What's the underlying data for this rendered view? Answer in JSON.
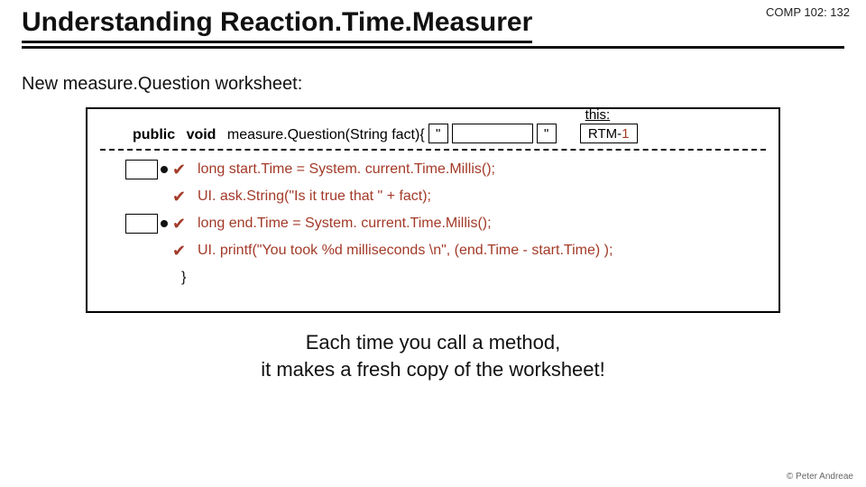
{
  "header": {
    "course_tag": "COMP 102: 132",
    "title": "Understanding Reaction.Time.Measurer"
  },
  "subhead": "New measure.Question worksheet:",
  "signature": {
    "kw_public": "public",
    "kw_void": "void",
    "method": "measure.Question(String fact){",
    "quote1": "\"",
    "quote2": "\"",
    "this_label": "this:",
    "rtm_text": "RTM-",
    "rtm_num": "1"
  },
  "lines": {
    "l1": "long start.Time = System. current.Time.Millis();",
    "l2": "UI. ask.String(\"Is it true that \" + fact);",
    "l3": "long end.Time = System. current.Time.Millis();",
    "l4": "UI. printf(\"You took %d milliseconds \\n\",  (end.Time - start.Time) );",
    "brace": "}"
  },
  "caption": {
    "line1": "Each time you call a method,",
    "line2": "it makes a fresh copy of the worksheet!"
  },
  "footer": "© Peter Andreae"
}
